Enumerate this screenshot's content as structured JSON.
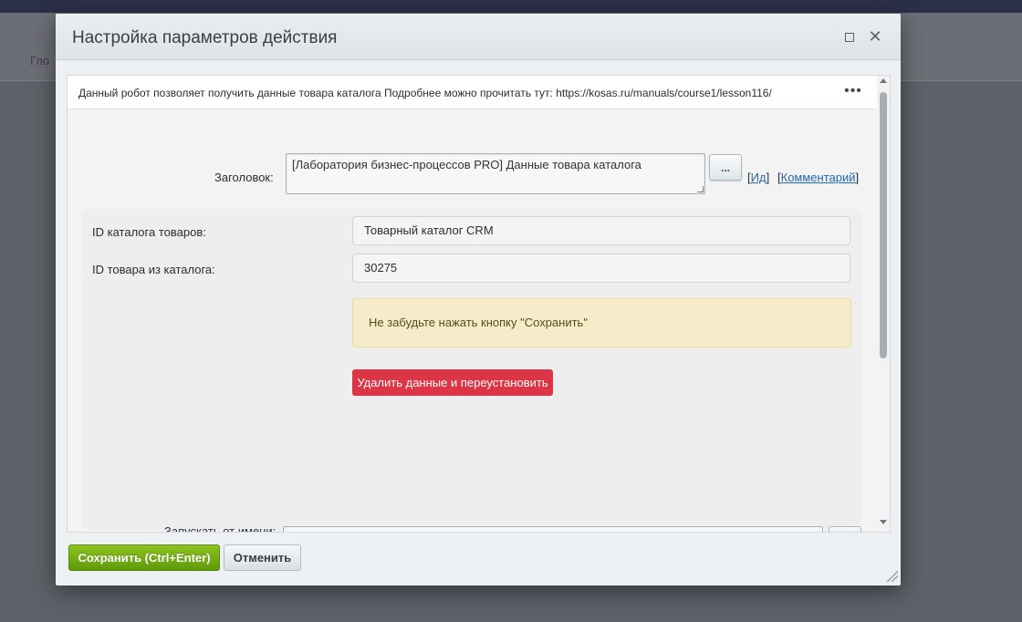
{
  "background": {
    "partial_text": "Гло"
  },
  "dialog": {
    "title": "Настройка параметров действия",
    "description": "Данный робот позволяет получить данные товара каталога Подробнее можно прочитать тут: https://kosas.ru/manuals/course1/lesson116/",
    "title_field": {
      "label": "Заголовок:",
      "value": "[Лаборатория бизнес-процессов PRO] Данные товара каталога"
    },
    "dots_label": "...",
    "links": {
      "id_label": "Ид",
      "comment_label": "Комментарий"
    },
    "fields": [
      {
        "label": "ID каталога товаров:",
        "value": "Товарный каталог CRM"
      },
      {
        "label": "ID товара из каталога:",
        "value": "30275"
      }
    ],
    "alert": "Не забудьте нажать кнопку \"Сохранить\"",
    "danger_button": "Удалить данные и переустановить",
    "cut_label": "Запускать от имени:",
    "save_button": "Сохранить (Ctrl+Enter)",
    "cancel_button": "Отменить"
  },
  "colors": {
    "save": "#6aa612",
    "danger": "#dc3545",
    "alert_bg": "#f7ecc9",
    "link": "#2067b0"
  }
}
